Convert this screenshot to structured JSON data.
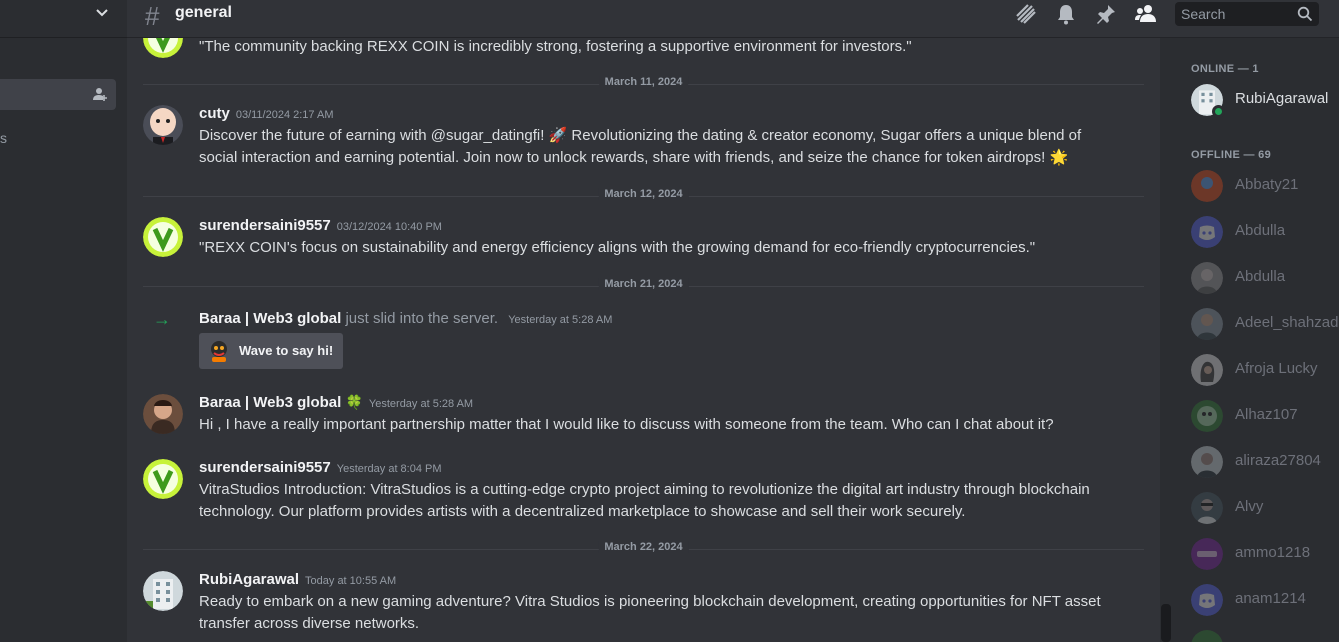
{
  "header": {
    "channel": "general",
    "search_placeholder": "Search"
  },
  "sidebar": {
    "partial_label": "s"
  },
  "messages": [
    {
      "type": "continuation",
      "text": "\"The community backing REXX COIN is incredibly strong, fostering a supportive environment for investors.\""
    },
    {
      "type": "divider",
      "date": "March 11, 2024"
    },
    {
      "type": "message",
      "user": "cuty",
      "time": "03/11/2024 2:17 AM",
      "text": "Discover the future of earning with @sugar_datingfi! 🚀 Revolutionizing the dating & creator economy, Sugar offers a unique blend of social interaction and earning potential. Join now to unlock rewards, share with friends, and seize the chance for token airdrops! 🌟"
    },
    {
      "type": "divider",
      "date": "March 12, 2024"
    },
    {
      "type": "message",
      "user": "surendersaini9557",
      "time": "03/12/2024 10:40 PM",
      "text": "\"REXX COIN's focus on sustainability and energy efficiency aligns with the growing demand for eco-friendly cryptocurrencies.\""
    },
    {
      "type": "divider",
      "date": "March 21, 2024"
    },
    {
      "type": "join",
      "user": "Baraa  | Web3 global",
      "action": "just slid into the server.",
      "time": "Yesterday at 5:28 AM",
      "button": "Wave to say hi!"
    },
    {
      "type": "message",
      "user": "Baraa  | Web3 global",
      "badge": "🍀",
      "time": "Yesterday at 5:28 AM",
      "text": "Hi , I have a really important partnership matter that I would like to discuss with someone from the team. Who can I chat about it?"
    },
    {
      "type": "message",
      "user": "surendersaini9557",
      "time": "Yesterday at 8:04 PM",
      "text": "VitraStudios Introduction: VitraStudios is a cutting-edge crypto project aiming to revolutionize the digital art industry through blockchain technology. Our platform provides artists with a decentralized marketplace to showcase and sell their work securely."
    },
    {
      "type": "divider",
      "date": "March 22, 2024"
    },
    {
      "type": "message",
      "user": "RubiAgarawal",
      "time": "Today at 10:55 AM",
      "text": "Ready to embark on a new gaming adventure? Vitra Studios is pioneering blockchain development, creating opportunities for NFT asset transfer across diverse networks."
    }
  ],
  "members": {
    "online_header": "ONLINE — 1",
    "online": [
      "RubiAgarawal"
    ],
    "offline_header": "OFFLINE — 69",
    "offline": [
      "Abbaty21",
      "Abdulla",
      "Abdulla",
      "Adeel_shahzad",
      "Afroja Lucky",
      "Alhaz107",
      "aliraza27804",
      "Alvy",
      "ammo1218",
      "anam1214"
    ]
  },
  "colors": {
    "background": "#313338",
    "sidebar": "#2b2d31",
    "online_green": "#23a55a",
    "discord_blurple": "#5865f2"
  }
}
